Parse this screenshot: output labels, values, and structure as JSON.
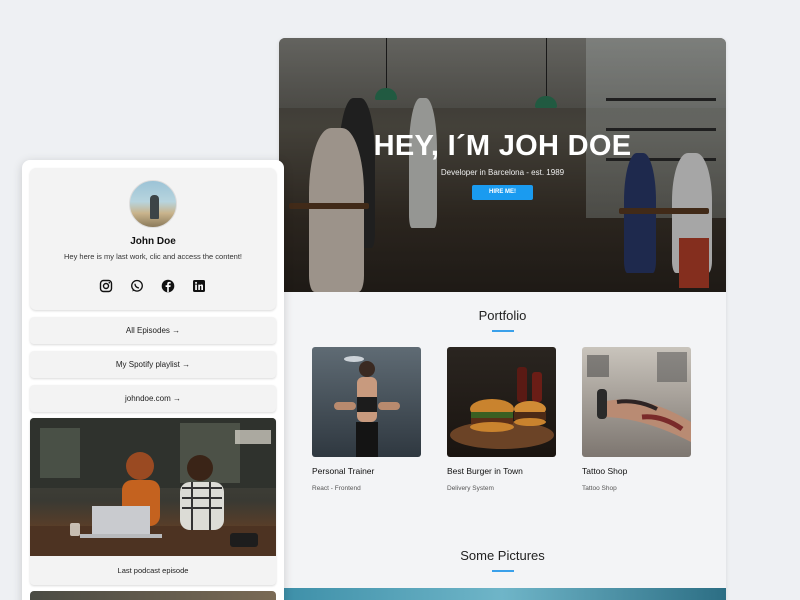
{
  "site": {
    "hero": {
      "title": "HEY, I´M JOH DOE",
      "subtitle": "Developer in Barcelona - est. 1989",
      "button_label": "HIRE ME!"
    },
    "portfolio": {
      "title": "Portfolio",
      "items": [
        {
          "name": "Personal Trainer",
          "tag": "React - Frontend"
        },
        {
          "name": "Best Burger in Town",
          "tag": "Delivery System"
        },
        {
          "name": "Tattoo Shop",
          "tag": "Tattoo Shop"
        }
      ]
    },
    "pictures": {
      "title": "Some Pictures"
    }
  },
  "bio": {
    "name": "John Doe",
    "description": "Hey here is my last work, clic and access the content!",
    "socials": [
      "instagram-icon",
      "whatsapp-icon",
      "facebook-icon",
      "linkedin-icon"
    ],
    "links": [
      {
        "label": "All Episodes →"
      },
      {
        "label": "My Spotify playlist →"
      },
      {
        "label": "johndoe.com →"
      }
    ],
    "podcast_caption": "Last podcast episode"
  },
  "colors": {
    "accent": "#1a9bf0",
    "underline": "#3aa0ea",
    "background": "#eef0f3",
    "card": "#f3f3f3"
  }
}
